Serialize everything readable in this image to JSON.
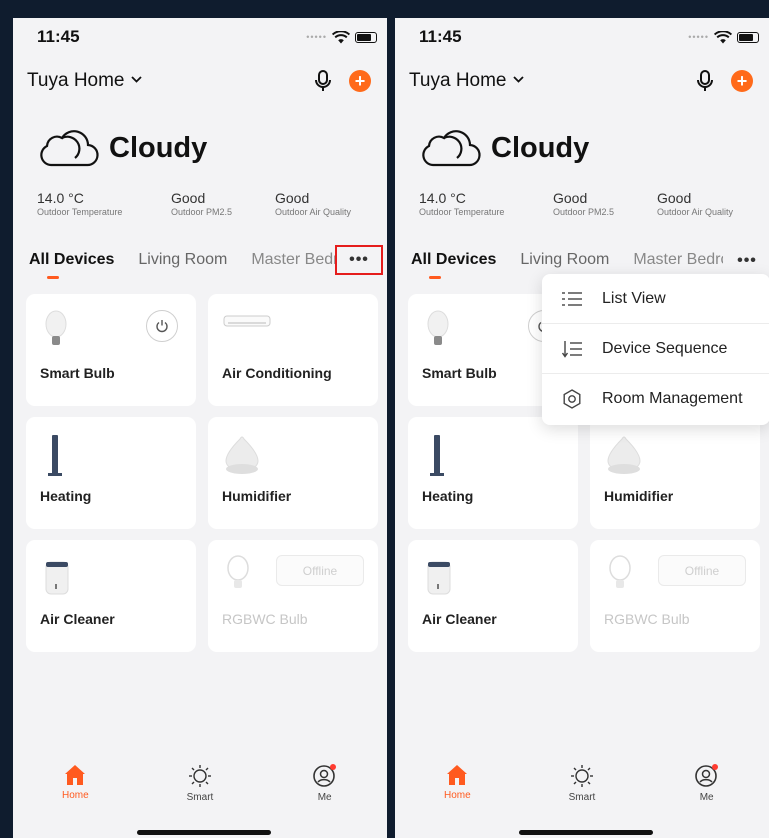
{
  "status": {
    "time": "11:45"
  },
  "header": {
    "home_name": "Tuya Home"
  },
  "weather": {
    "condition": "Cloudy"
  },
  "stats": [
    {
      "value": "14.0 °C",
      "label": "Outdoor Temperature"
    },
    {
      "value": "Good",
      "label": "Outdoor PM2.5"
    },
    {
      "value": "Good",
      "label": "Outdoor Air Quality"
    }
  ],
  "tabs": {
    "all": "All Devices",
    "living": "Living Room",
    "master_left": "Master Bedro",
    "master_right": "Master Bedroo"
  },
  "devices": {
    "d1": "Smart Bulb",
    "d2": "Air Conditioning",
    "d3": "Heating",
    "d4": "Humidifier",
    "d5": "Air Cleaner",
    "d6": "RGBWC Bulb",
    "offline_label": "Offline"
  },
  "menu": {
    "list_view": "List View",
    "device_sequence": "Device Sequence",
    "room_management": "Room Management"
  },
  "bottom_tabs": {
    "home": "Home",
    "smart": "Smart",
    "me": "Me"
  },
  "colors": {
    "accent": "#ff5a1f",
    "highlight_box": "#e51c1c",
    "background": "#0f1c2e"
  }
}
